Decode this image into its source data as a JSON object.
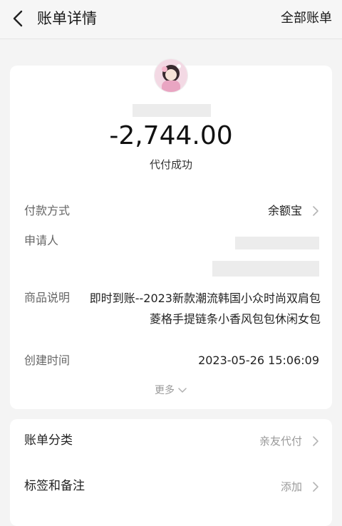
{
  "header": {
    "title": "账单详情",
    "action": "全部账单",
    "back_icon": "chevron-left-icon"
  },
  "summary": {
    "amount": "-2,744.00",
    "status": "代付成功"
  },
  "details": {
    "payment_method": {
      "label": "付款方式",
      "value": "余额宝"
    },
    "applicant": {
      "label": "申请人"
    },
    "description": {
      "label": "商品说明",
      "value": "即时到账--2023新款潮流韩国小众时尚双肩包菱格手提链条小香风包包休闲女包"
    },
    "created_time": {
      "label": "创建时间",
      "value": "2023-05-26 15:06:09"
    },
    "more": "更多"
  },
  "extra": {
    "category": {
      "label": "账单分类",
      "value": "亲友代付"
    },
    "tags": {
      "label": "标签和备注",
      "value": "添加"
    }
  },
  "colors": {
    "page_bg": "#f4f4f4",
    "card_bg": "#ffffff",
    "muted_text": "#999999",
    "label_text": "#666666",
    "mask": "#ececec"
  }
}
